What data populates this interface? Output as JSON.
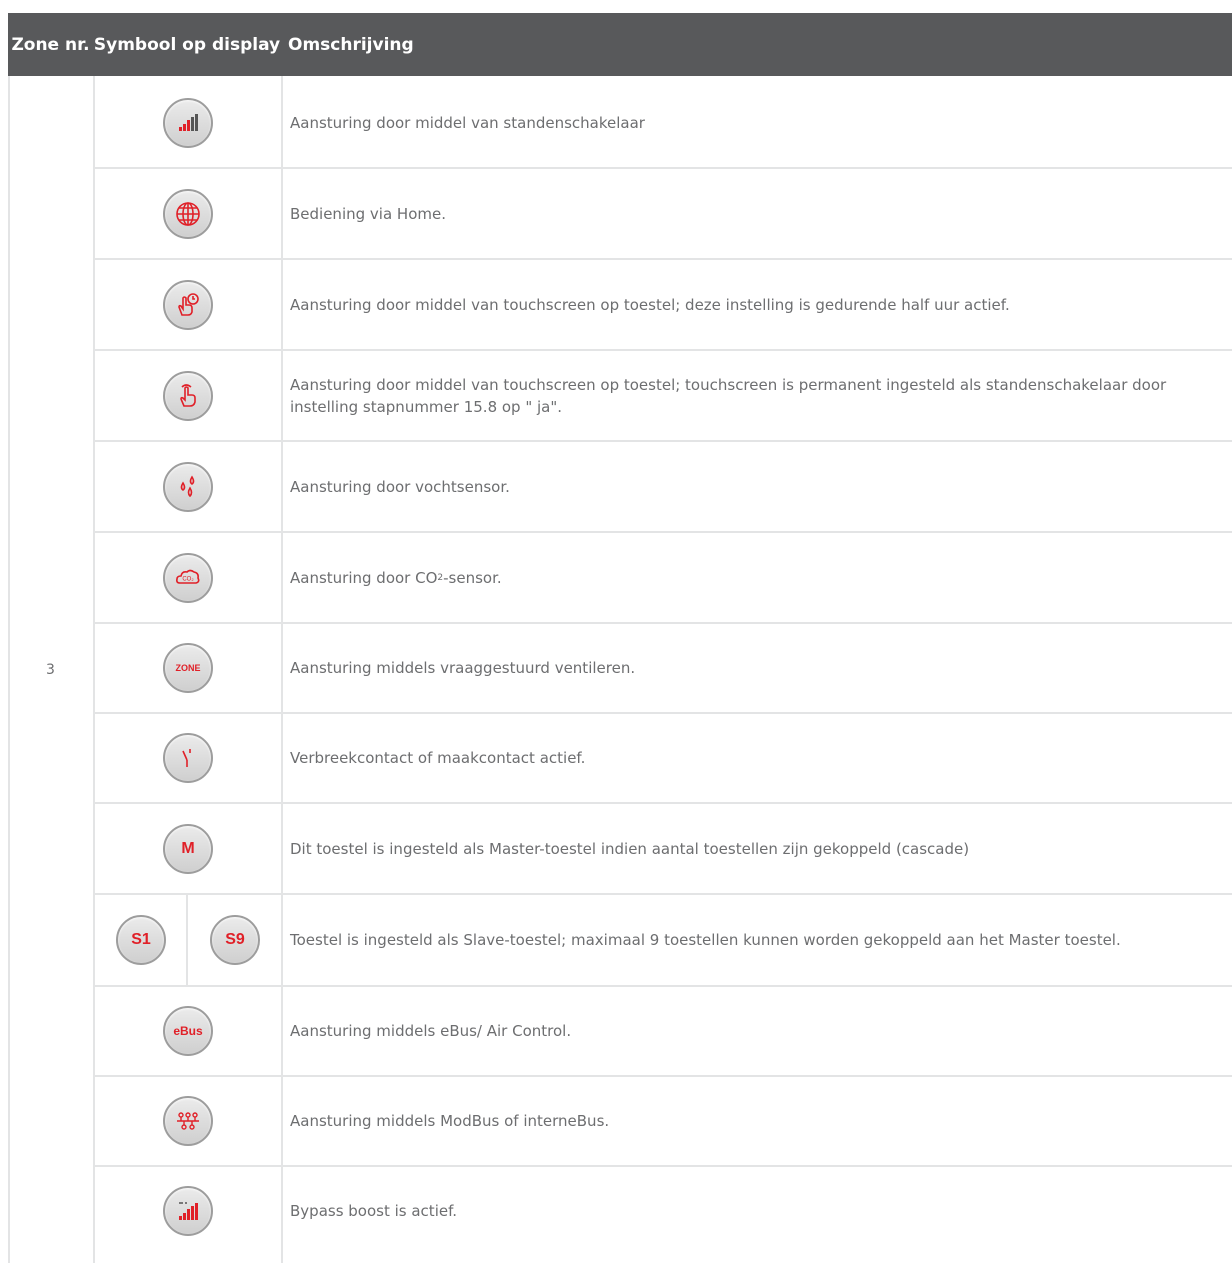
{
  "header": {
    "zone": "Zone nr.",
    "symbol": "Symbool op display",
    "description": "Omschrijving"
  },
  "zone_value": "3",
  "rows": [
    {
      "icon": "signal-bars-icon",
      "description": "Aansturing door middel van standenschakelaar"
    },
    {
      "icon": "globe-icon",
      "description": "Bediening via Home."
    },
    {
      "icon": "touch-timer-icon",
      "description": "Aansturing door middel van touchscreen op toestel; deze instelling is gedurende half uur actief."
    },
    {
      "icon": "touch-hand-icon",
      "description": "Aansturing door middel van touchscreen op toestel; touchscreen is permanent ingesteld als standenschakelaar door instelling stapnummer 15.8 op \" ja\"."
    },
    {
      "icon": "humidity-drops-icon",
      "description": "Aansturing door vochtsensor."
    },
    {
      "icon": "co2-cloud-icon",
      "description_prefix": "Aansturing door CO",
      "description_sub": "2",
      "description_suffix": "-sensor.",
      "icon_text": "CO₂"
    },
    {
      "icon": "zone-icon",
      "icon_text": "ZONE",
      "description": "Aansturing middels vraaggestuurd ventileren."
    },
    {
      "icon": "contact-switch-icon",
      "description": "Verbreekcontact of maakcontact actief."
    },
    {
      "icon": "master-icon",
      "icon_text": "M",
      "description": "Dit toestel is ingesteld als Master-toestel indien aantal toestellen zijn gekoppeld (cascade)"
    },
    {
      "icon": "slave-icon",
      "icon_text_a": "S1",
      "icon_text_b": "S9",
      "description": "Toestel is ingesteld als Slave-toestel; maximaal 9 toestellen kunnen worden gekoppeld aan het Master toestel."
    },
    {
      "icon": "ebus-icon",
      "icon_text": "eBus",
      "description": "Aansturing middels eBus/ Air Control."
    },
    {
      "icon": "modbus-icon",
      "description": "Aansturing middels ModBus of interneBus."
    },
    {
      "icon": "bypass-boost-icon",
      "description": "Bypass boost is actief."
    }
  ],
  "colors": {
    "header_bg": "#58595b",
    "icon_red": "#e02028",
    "text": "#6d6e70",
    "grid": "#e3e4e5"
  }
}
